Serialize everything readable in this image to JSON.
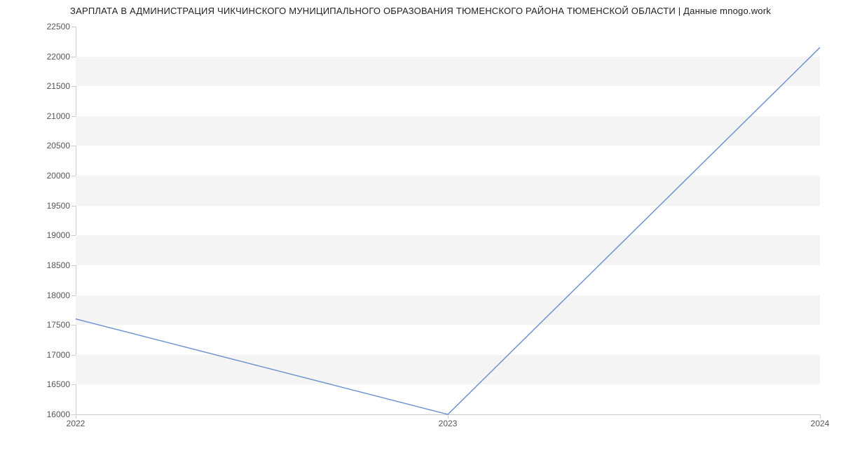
{
  "chart_data": {
    "type": "line",
    "title": "ЗАРПЛАТА В АДМИНИСТРАЦИЯ ЧИКЧИНСКОГО МУНИЦИПАЛЬНОГО ОБРАЗОВАНИЯ ТЮМЕНСКОГО РАЙОНА ТЮМЕНСКОЙ ОБЛАСТИ | Данные mnogo.work",
    "xlabel": "",
    "ylabel": "",
    "categories": [
      "2022",
      "2023",
      "2024"
    ],
    "x": [
      2022,
      2023,
      2024
    ],
    "values": [
      17600,
      16000,
      22150
    ],
    "y_ticks": [
      16000,
      16500,
      17000,
      17500,
      18000,
      18500,
      19000,
      19500,
      20000,
      20500,
      21000,
      21500,
      22000,
      22500
    ],
    "x_ticks": [
      "2022",
      "2023",
      "2024"
    ],
    "ylim": [
      16000,
      22500
    ],
    "xlim": [
      2022,
      2024
    ],
    "line_color": "#6f93d1",
    "grid": true
  }
}
